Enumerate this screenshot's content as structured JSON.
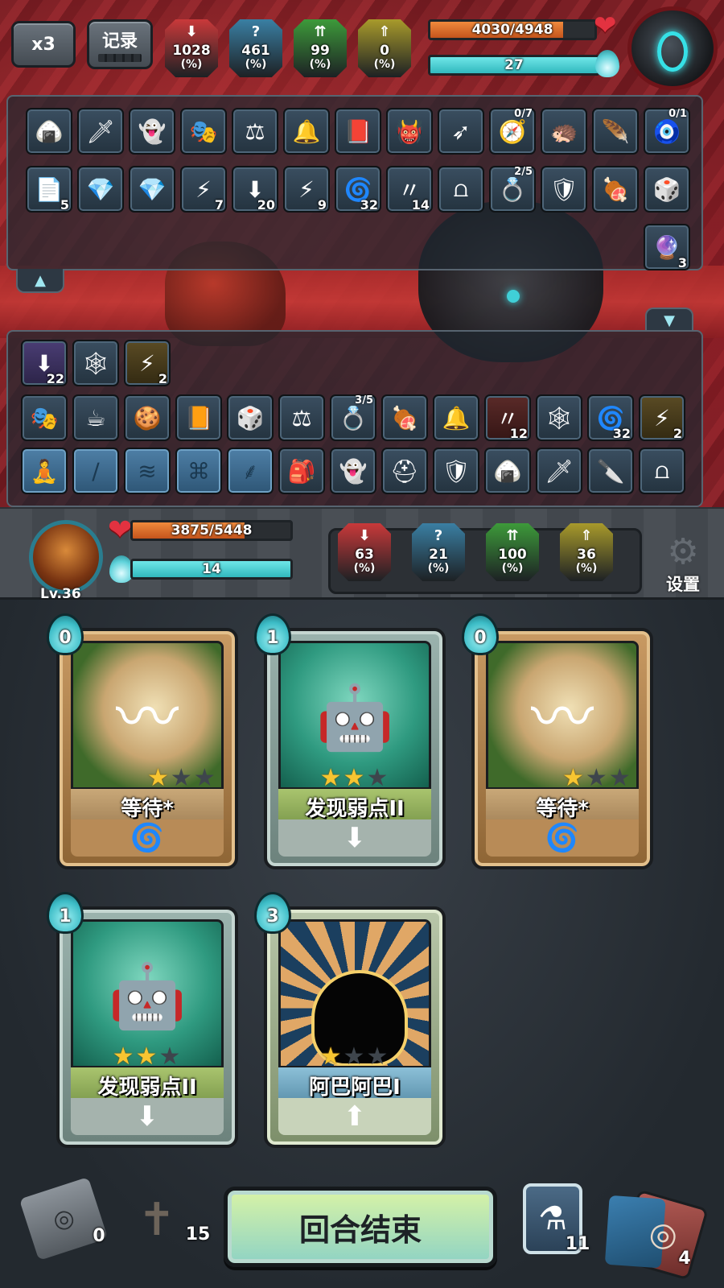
{
  "top_bar": {
    "speed_label": "x3",
    "log_label": "记录",
    "enemy_stats": [
      {
        "value": "1028",
        "unit": "(%)",
        "color": "#c9393a",
        "icon": "attack-down-icon"
      },
      {
        "value": "461",
        "unit": "(%)",
        "color": "#3a7fa3",
        "icon": "question-icon"
      },
      {
        "value": "99",
        "unit": "(%)",
        "color": "#3d9a3a",
        "icon": "attack-up-icon"
      },
      {
        "value": "0",
        "unit": "(%)",
        "color": "#a89a2b",
        "icon": "defense-up-icon"
      }
    ],
    "enemy_hp": "4030/4948",
    "enemy_hp_fraction": 0.81,
    "enemy_energy": "27",
    "enemy_energy_fraction": 1.0
  },
  "enemy_items": [
    {
      "icon": "rice-ball-icon",
      "glyph": "🍙",
      "count": ""
    },
    {
      "icon": "red-blade-icon",
      "glyph": "🗡",
      "count": ""
    },
    {
      "icon": "ghost-doll-icon",
      "glyph": "👻",
      "count": ""
    },
    {
      "icon": "mask-icon",
      "glyph": "🎭",
      "count": ""
    },
    {
      "icon": "scales-icon",
      "glyph": "⚖",
      "count": ""
    },
    {
      "icon": "horn-icon",
      "glyph": "🔔",
      "count": ""
    },
    {
      "icon": "book-icon",
      "glyph": "📕",
      "count": ""
    },
    {
      "icon": "red-imp-icon",
      "glyph": "👹",
      "count": ""
    },
    {
      "icon": "arrows-icon",
      "glyph": "➶",
      "count": ""
    },
    {
      "icon": "compass-icon",
      "glyph": "🧭",
      "count": "0/7"
    },
    {
      "icon": "spiked-shell-icon",
      "glyph": "🦔",
      "count": ""
    },
    {
      "icon": "feather-icon",
      "glyph": "🪶",
      "count": ""
    },
    {
      "icon": "eye-amulet-icon",
      "glyph": "🧿",
      "count": "0/1"
    },
    {
      "icon": "paper-icon",
      "glyph": "📄",
      "count": "5"
    },
    {
      "icon": "purple-crystal-icon",
      "glyph": "💎",
      "count": ""
    },
    {
      "icon": "purple-crystal-icon",
      "glyph": "💎",
      "count": ""
    },
    {
      "icon": "lightning-icon",
      "glyph": "⚡",
      "count": "7"
    },
    {
      "icon": "weaken-icon",
      "glyph": "⬇",
      "count": "20"
    },
    {
      "icon": "storm-icon",
      "glyph": "⚡",
      "count": "9"
    },
    {
      "icon": "vortex-icon",
      "glyph": "🌀",
      "count": "32"
    },
    {
      "icon": "claw-marks-icon",
      "glyph": "〃",
      "count": "14"
    },
    {
      "icon": "trap-icon",
      "glyph": "⩍",
      "count": ""
    },
    {
      "icon": "gold-ring-icon",
      "glyph": "💍",
      "count": "2/5"
    },
    {
      "icon": "shield-icon",
      "glyph": "🛡",
      "count": ""
    },
    {
      "icon": "meat-icon",
      "glyph": "🍖",
      "count": ""
    },
    {
      "icon": "cube-icon",
      "glyph": "🎲",
      "count": ""
    },
    {
      "icon": "frost-orb-icon",
      "glyph": "🔮",
      "count": "3"
    }
  ],
  "player_items": [
    {
      "icon": "weaken-icon",
      "glyph": "⬇",
      "count": "22",
      "tone": "purple"
    },
    {
      "icon": "spider-web-icon",
      "glyph": "🕸",
      "count": "",
      "tone": ""
    },
    {
      "icon": "lightning-icon",
      "glyph": "⚡",
      "count": "2",
      "tone": "gold"
    },
    {
      "icon": "mask-icon",
      "glyph": "🎭",
      "count": "",
      "tone": ""
    },
    {
      "icon": "teacup-icon",
      "glyph": "☕",
      "count": "",
      "tone": ""
    },
    {
      "icon": "cookie-icon",
      "glyph": "🍪",
      "count": "",
      "tone": ""
    },
    {
      "icon": "spellbook-icon",
      "glyph": "📙",
      "count": "",
      "tone": ""
    },
    {
      "icon": "cube-icon",
      "glyph": "🎲",
      "count": "",
      "tone": ""
    },
    {
      "icon": "scales-icon",
      "glyph": "⚖",
      "count": "",
      "tone": ""
    },
    {
      "icon": "gold-ring-icon",
      "glyph": "💍",
      "count": "3/5",
      "tone": ""
    },
    {
      "icon": "meat-icon",
      "glyph": "🍖",
      "count": "",
      "tone": ""
    },
    {
      "icon": "horn-icon",
      "glyph": "🔔",
      "count": "",
      "tone": ""
    },
    {
      "icon": "claw-marks-icon",
      "glyph": "〃",
      "count": "12",
      "tone": "red"
    },
    {
      "icon": "spider-web-icon",
      "glyph": "🕸",
      "count": "",
      "tone": ""
    },
    {
      "icon": "vortex-icon",
      "glyph": "🌀",
      "count": "32",
      "tone": ""
    },
    {
      "icon": "storm-icon",
      "glyph": "⚡",
      "count": "2",
      "tone": "gold"
    },
    {
      "icon": "meditate-slot-icon",
      "glyph": "🧘",
      "count": "",
      "tone": "ghost"
    },
    {
      "icon": "staff-slot-icon",
      "glyph": "∕",
      "count": "",
      "tone": "ghost"
    },
    {
      "icon": "wind-slot-icon",
      "glyph": "≋",
      "count": "",
      "tone": "ghost"
    },
    {
      "icon": "scroll-slot-icon",
      "glyph": "⌘",
      "count": "",
      "tone": "ghost"
    },
    {
      "icon": "feather-slot-icon",
      "glyph": "⸙",
      "count": "",
      "tone": "ghost"
    },
    {
      "icon": "bag-icon",
      "glyph": "🎒",
      "count": "",
      "tone": ""
    },
    {
      "icon": "ghost-doll-icon",
      "glyph": "👻",
      "count": "",
      "tone": ""
    },
    {
      "icon": "helmet-icon",
      "glyph": "⛑",
      "count": "",
      "tone": ""
    },
    {
      "icon": "shield-icon",
      "glyph": "🛡",
      "count": "",
      "tone": ""
    },
    {
      "icon": "rice-ball-icon",
      "glyph": "🍙",
      "count": "",
      "tone": ""
    },
    {
      "icon": "red-blade-icon",
      "glyph": "🗡",
      "count": "",
      "tone": ""
    },
    {
      "icon": "kunai-icon",
      "glyph": "🔪",
      "count": "",
      "tone": ""
    },
    {
      "icon": "trap-icon",
      "glyph": "⩍",
      "count": "",
      "tone": ""
    }
  ],
  "player": {
    "level": "Lv.36",
    "hp": "3875/5448",
    "hp_fraction": 0.71,
    "energy": "14",
    "energy_fraction": 1.0,
    "stats": [
      {
        "value": "63",
        "unit": "(%)",
        "color": "#c9393a",
        "icon": "attack-down-icon"
      },
      {
        "value": "21",
        "unit": "(%)",
        "color": "#3a7fa3",
        "icon": "question-icon"
      },
      {
        "value": "100",
        "unit": "(%)",
        "color": "#3d9a3a",
        "icon": "attack-up-icon"
      },
      {
        "value": "36",
        "unit": "(%)",
        "color": "#a89a2b",
        "icon": "defense-up-icon"
      }
    ],
    "settings_label": "设置"
  },
  "hand": [
    {
      "name": "等待*",
      "cost": "0",
      "kind": "skill",
      "stars": 1,
      "motif": "〰",
      "type_icon": "spiral-icon",
      "type_glyph": "🌀"
    },
    {
      "name": "发现弱点II",
      "cost": "1",
      "kind": "attack",
      "stars": 2,
      "motif": "🤖",
      "type_icon": "arrow-down-icon",
      "type_glyph": "⬇"
    },
    {
      "name": "等待*",
      "cost": "0",
      "kind": "skill",
      "stars": 1,
      "motif": "〰",
      "type_icon": "spiral-icon",
      "type_glyph": "🌀"
    },
    {
      "name": "发现弱点II",
      "cost": "1",
      "kind": "attack",
      "stars": 2,
      "motif": "🤖",
      "type_icon": "arrow-down-icon",
      "type_glyph": "⬇"
    },
    {
      "name": "阿巴阿巴I",
      "cost": "3",
      "kind": "power",
      "stars": 1,
      "motif": "",
      "type_icon": "arrow-up-icon",
      "type_glyph": "⬆"
    }
  ],
  "bottom": {
    "exhaust_count": "0",
    "discard_count": "15",
    "end_turn_label": "回合结束",
    "potion_count": "11",
    "draw_count": "4"
  }
}
